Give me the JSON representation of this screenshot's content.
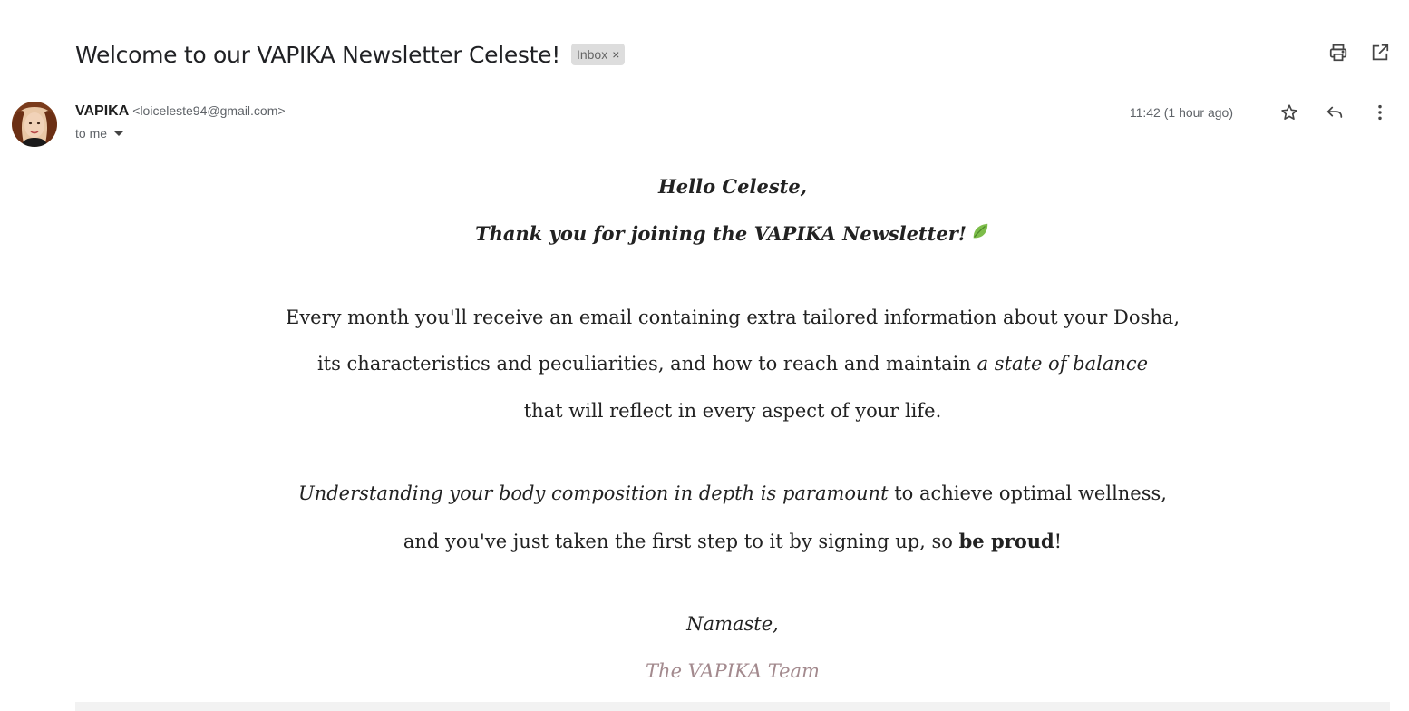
{
  "email": {
    "subject": "Welcome to our VAPIKA Newsletter Celeste!",
    "label": "Inbox",
    "label_remove": "×",
    "sender_name": "VAPIKA",
    "sender_email": "<loiceleste94@gmail.com>",
    "recipient": "to me",
    "timestamp": "11:42 (1 hour ago)"
  },
  "icons": {
    "print": "print-icon",
    "open_new_window": "open-in-new-window-icon",
    "star": "star-icon",
    "reply": "reply-icon",
    "more": "more-vertical-icon",
    "leaf": "leaf-icon"
  },
  "body": {
    "greeting": "Hello Celeste,",
    "thanks": "Thank you for joining the VAPIKA Newsletter!",
    "para1_line1": "Every month you'll receive an email containing extra tailored information about your Dosha,",
    "para1_line2_a": "its characteristics and peculiarities, and how to reach and maintain ",
    "para1_line2_em": "a state of balance",
    "para1_line3": "that will reflect in every aspect of your life.",
    "para2_line1_em": "Understanding your body composition in depth is paramount",
    "para2_line1_b": " to achieve optimal wellness,",
    "para2_line2_a": "and you've just taken the first step to it by signing up, so ",
    "para2_line2_strong": "be proud",
    "para2_line2_c": "!",
    "signoff": "Namaste,",
    "signature": "The VAPIKA Team"
  },
  "colors": {
    "signature": "#a38a8e",
    "label_chip_bg": "#dddddd",
    "leaf": "#7dbd4a"
  }
}
